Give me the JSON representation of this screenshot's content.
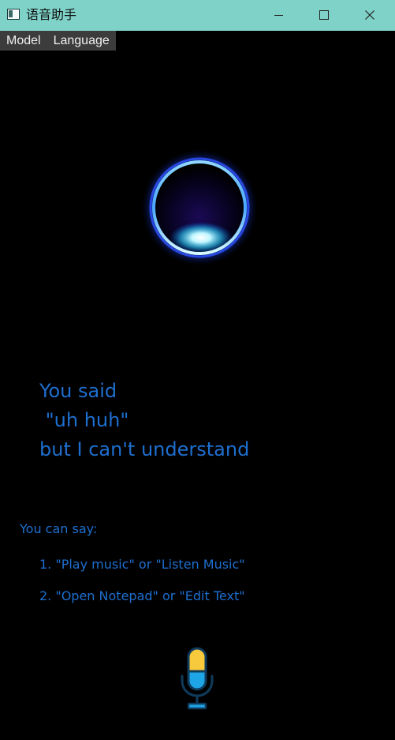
{
  "window": {
    "title": "语音助手"
  },
  "menu": {
    "items": [
      "Model",
      "Language"
    ]
  },
  "message": {
    "line1": "You said",
    "line2": " \"uh huh\"",
    "line3": "but I can't understand"
  },
  "hints": {
    "title": "You can say:",
    "items": [
      "1. \"Play music\" or \"Listen Music\"",
      "2. \"Open Notepad\" or \"Edit Text\""
    ]
  },
  "colors": {
    "titlebar": "#7fd2c8",
    "menubar": "#3c3c3c",
    "text_accent": "#1e6fcf",
    "mic_top": "#f7c93c",
    "mic_bottom": "#1ea5e6",
    "mic_outline": "#0f3b5c"
  },
  "icons": {
    "app": "app-window-icon",
    "minimize": "minimize-icon",
    "maximize": "maximize-icon",
    "close": "close-icon",
    "orb": "voice-orb-icon",
    "mic": "microphone-icon"
  }
}
